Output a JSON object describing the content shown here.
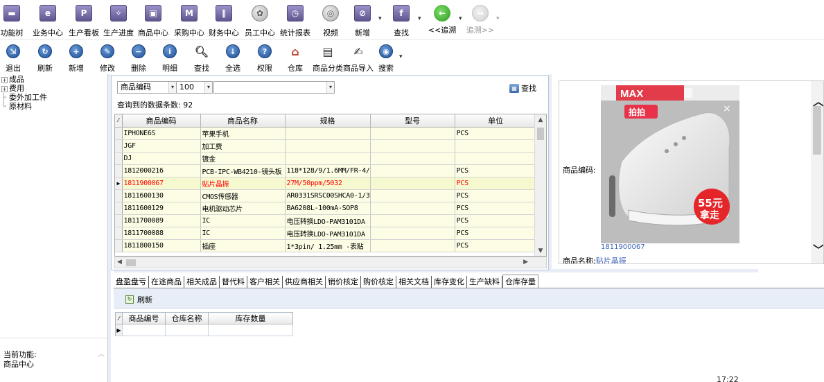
{
  "top_toolbar": [
    {
      "label": "功能树",
      "icon": "function-tree-icon"
    },
    {
      "label": "业务中心",
      "icon": "business-center-icon"
    },
    {
      "label": "生产看板",
      "icon": "production-board-icon"
    },
    {
      "label": "生产进度",
      "icon": "production-progress-icon"
    },
    {
      "label": "商品中心",
      "icon": "product-center-icon"
    },
    {
      "label": "采购中心",
      "icon": "purchase-center-icon"
    },
    {
      "label": "财务中心",
      "icon": "finance-center-icon"
    },
    {
      "label": "员工中心",
      "icon": "staff-center-icon"
    },
    {
      "label": "统计报表",
      "icon": "statistics-report-icon"
    },
    {
      "label": "视频",
      "icon": "video-icon"
    },
    {
      "label": "新增",
      "icon": "add-icon"
    },
    {
      "label": "查找",
      "icon": "find-icon"
    },
    {
      "label": "<<追溯",
      "icon": "trace-back-icon"
    },
    {
      "label": "追溯>>",
      "icon": "trace-forward-icon"
    }
  ],
  "action_toolbar": [
    {
      "label": "退出"
    },
    {
      "label": "刷新"
    },
    {
      "label": "新增"
    },
    {
      "label": "修改"
    },
    {
      "label": "删除"
    },
    {
      "label": "明细"
    },
    {
      "label": "查找"
    },
    {
      "label": "全选"
    },
    {
      "label": "权限"
    },
    {
      "label": "仓库"
    },
    {
      "label": "商品分类"
    },
    {
      "label": "商品导入"
    },
    {
      "label": "搜索"
    }
  ],
  "tree": [
    {
      "label": "成品",
      "expander": "+"
    },
    {
      "label": "费用",
      "expander": "+"
    },
    {
      "label": "委外加工件",
      "expander": ""
    },
    {
      "label": "原材料",
      "expander": ""
    }
  ],
  "current_function": {
    "title": "当前功能:",
    "value": "商品中心"
  },
  "search": {
    "field": "商品编码",
    "limit": "100",
    "keyword": "",
    "button": "查找",
    "count_text": "查询到的数据条数: 92"
  },
  "grid": {
    "columns": [
      "商品编码",
      "商品名称",
      "规格",
      "型号",
      "单位"
    ],
    "rows": [
      [
        "IPHONE6S",
        "苹果手机",
        "",
        "",
        "PCS"
      ],
      [
        "JGF",
        "加工费",
        "",
        "",
        ""
      ],
      [
        "DJ",
        "镀金",
        "",
        "",
        ""
      ],
      [
        "1812000216",
        "PCB-IPC-WB4210-镜头板",
        "118*128/9/1.6MM/FR-4/",
        "",
        "PCS"
      ],
      [
        "1811900067",
        "贴片晶振",
        "27M/50ppm/5032",
        "",
        "PCS"
      ],
      [
        "1811600130",
        "CMOS传感器",
        "AR0331SRSC00SHCA0-1/3",
        "",
        "PCS"
      ],
      [
        "1811600129",
        "电机驱动芯片",
        "BA6208L-100mA-SOP8",
        "",
        "PCS"
      ],
      [
        "1811700089",
        "IC",
        "电压转换LDO-PAM3101DA",
        "",
        "PCS"
      ],
      [
        "1811700088",
        "IC",
        "电压转换LDO-PAM3101DA",
        "",
        "PCS"
      ],
      [
        "1811800150",
        "插座",
        "1*3pin/ 1.25mm -表贴",
        "",
        "PCS"
      ]
    ],
    "selected_row": 4
  },
  "preview": {
    "code_label": "商品编码:",
    "code_value": "1811900067",
    "name_label": "商品名称:",
    "name_value": "贴片晶振",
    "ad_brand": "MAX",
    "ad_badge": "拍拍",
    "ad_price": "55元",
    "ad_slogan": "拿走"
  },
  "tabs": [
    "盘盈盘亏",
    "在途商品",
    "相关成品",
    "替代料",
    "客户相关",
    "供应商相关",
    "销价核定",
    "购价核定",
    "相关文档",
    "库存变化",
    "生产缺料",
    "仓库存量"
  ],
  "active_tab": 11,
  "bottom": {
    "refresh_label": "刷新",
    "columns": [
      "商品编号",
      "仓库名称",
      "库存数量"
    ]
  },
  "clock": "17:22"
}
